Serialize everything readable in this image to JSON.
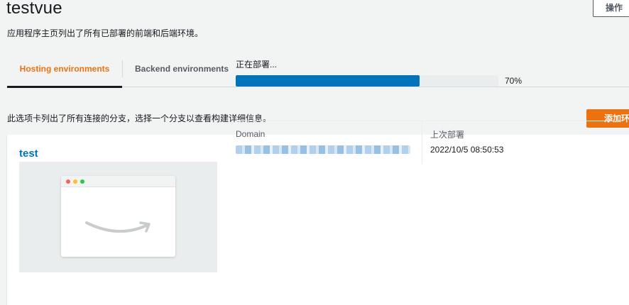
{
  "app": {
    "title": "testvue",
    "description": "应用程序主页列出了所有已部署的前端和后端环境。",
    "actions_label": "操作"
  },
  "tabs": [
    {
      "label": "Hosting environments",
      "active": true
    },
    {
      "label": "Backend environments",
      "active": false
    }
  ],
  "hosting": {
    "description": "此选项卡列出了所有连接的分支，选择一个分支以查看构建详细信息。",
    "add_button_label": "添加环境"
  },
  "branch": {
    "name": "test",
    "status": "正在部署...",
    "progress_percent": 70,
    "progress_label": "70%",
    "domain_label": "Domain",
    "domain_value_obscured": true,
    "last_deploy_label": "上次部署",
    "last_deploy_value": "2022/10/5 08:50:53"
  },
  "colors": {
    "accent": "#ec7211",
    "link": "#0073bb",
    "progress": "#0073bb"
  },
  "icons": [
    "amazon-smile-icon",
    "browser-window-icon"
  ]
}
